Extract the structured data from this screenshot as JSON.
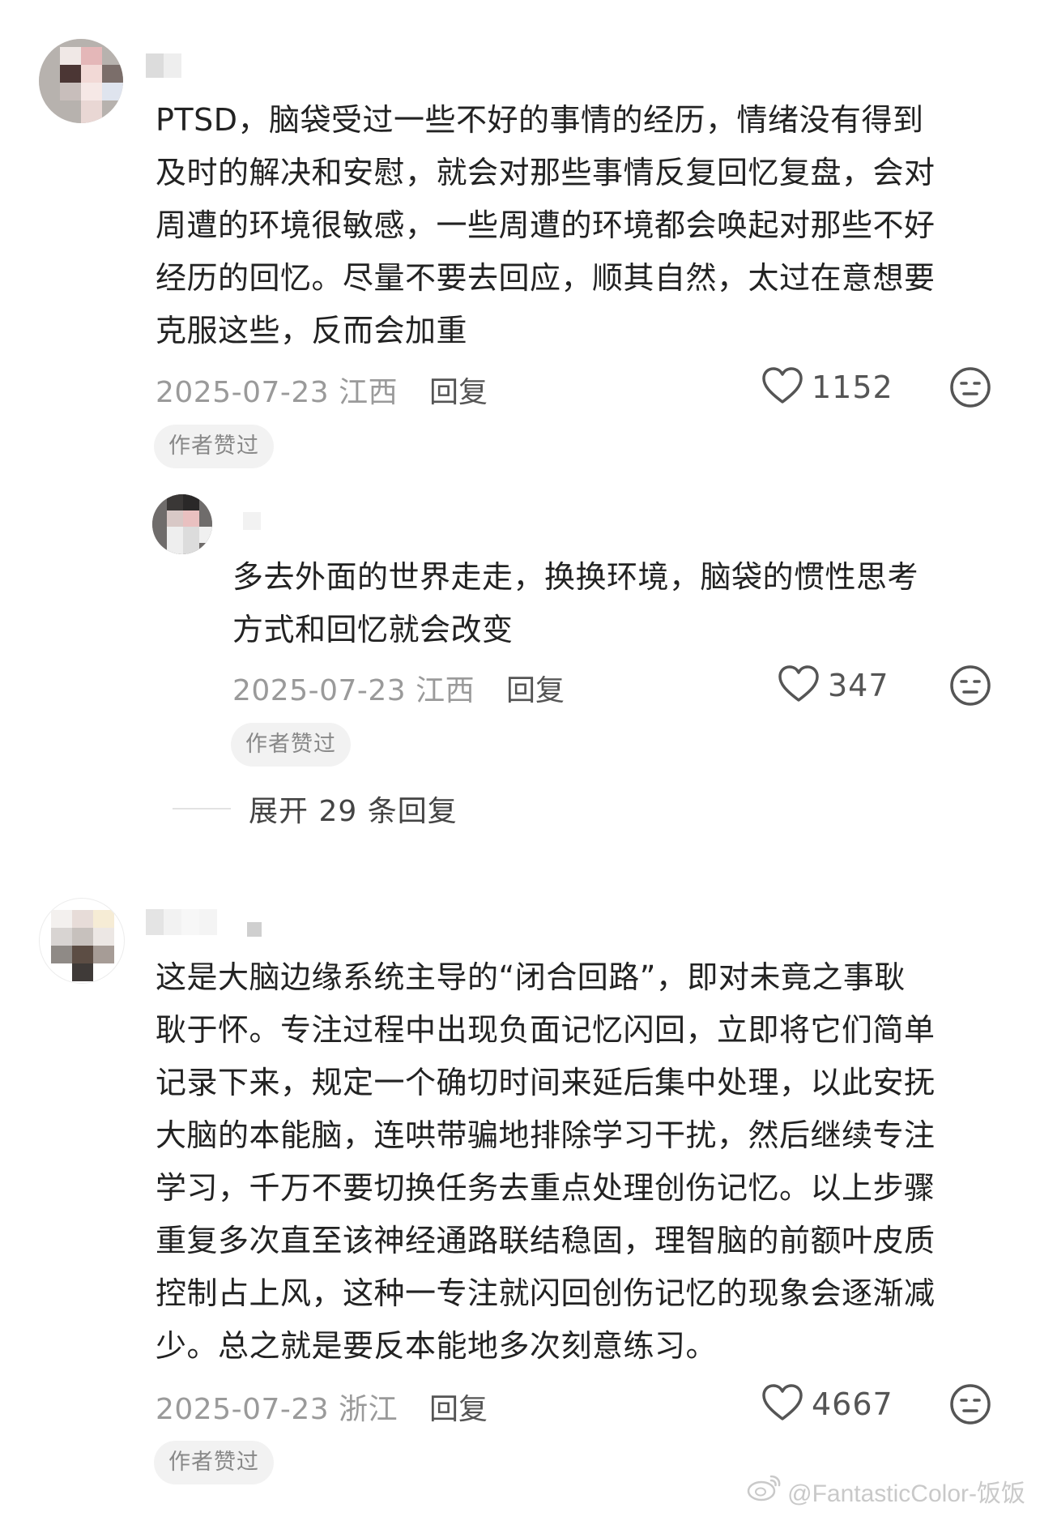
{
  "comments": [
    {
      "text": "PTSD，脑袋受过一些不好的事情的经历，情绪没有得到\n及时的解决和安慰，就会对那些事情反复回忆复盘，会对\n周遭的环境很敏感，一些周遭的环境都会唤起对那些不好\n经历的回忆。尽量不要去回应，顺其自然，太过在意想要\n克服这些，反而会加重",
      "date_location": "2025-07-23 江西",
      "reply_label": "回复",
      "likes": "1152",
      "badge": "作者赞过"
    },
    {
      "text": "多去外面的世界走走，换换环境，脑袋的惯性思考\n方式和回忆就会改变",
      "date_location": "2025-07-23 江西",
      "reply_label": "回复",
      "likes": "347",
      "badge": "作者赞过"
    },
    {
      "text": "这是大脑边缘系统主导的“闭合回路”，即对未竟之事耿\n耿于怀。专注过程中出现负面记忆闪回，立即将它们简单\n记录下来，规定一个确切时间来延后集中处理，以此安抚\n大脑的本能脑，连哄带骗地排除学习干扰，然后继续专注\n学习，千万不要切换任务去重点处理创伤记忆。以上步骤\n重复多次直至该神经通路联结稳固，理智脑的前额叶皮质\n控制占上风，这种一专注就闪回创伤记忆的现象会逐渐减\n少。总之就是要反本能地多次刻意练习。",
      "date_location": "2025-07-23 浙江",
      "reply_label": "回复",
      "likes": "4667",
      "badge": "作者赞过"
    }
  ],
  "expand_replies": "展开 29 条回复",
  "watermark": "@FantasticColor-饭饭",
  "icons": {
    "like": "heart-outline-icon",
    "emoji": "neutral-face-icon",
    "watermark": "weibo-logo-icon"
  },
  "colors": {
    "text": "#222222",
    "meta": "#9a9a9a",
    "badge_bg": "#f2f2f2",
    "badge_text": "#888888"
  }
}
